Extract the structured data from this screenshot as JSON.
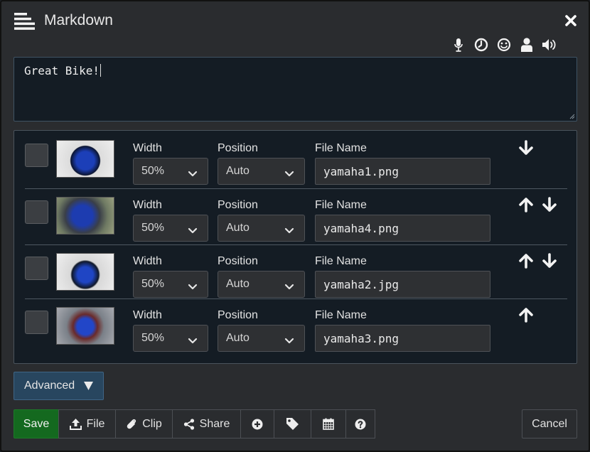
{
  "window": {
    "title": "Markdown"
  },
  "toolbar_icons": [
    "microphone-icon",
    "clock-icon",
    "smiley-icon",
    "user-icon",
    "volume-icon"
  ],
  "editor": {
    "value": "Great Bike!"
  },
  "images": {
    "labels": {
      "width": "Width",
      "position": "Position",
      "file_name": "File Name"
    },
    "rows": [
      {
        "width": "50%",
        "position": "Auto",
        "file_name": "yamaha1.png",
        "can_move_up": false,
        "can_move_down": true
      },
      {
        "width": "50%",
        "position": "Auto",
        "file_name": "yamaha4.png",
        "can_move_up": true,
        "can_move_down": true
      },
      {
        "width": "50%",
        "position": "Auto",
        "file_name": "yamaha2.jpg",
        "can_move_up": true,
        "can_move_down": true
      },
      {
        "width": "50%",
        "position": "Auto",
        "file_name": "yamaha3.png",
        "can_move_up": true,
        "can_move_down": false
      }
    ]
  },
  "advanced": {
    "label": "Advanced"
  },
  "actions": {
    "save": "Save",
    "file": "File",
    "clip": "Clip",
    "share": "Share",
    "cancel": "Cancel"
  },
  "colors": {
    "save": "#14691f",
    "advanced": "#28465f",
    "background": "#2a2c2f",
    "panel": "#141c24"
  }
}
